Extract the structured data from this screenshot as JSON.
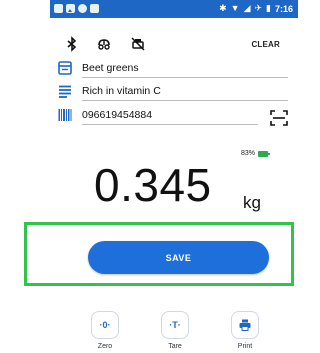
{
  "status_bar": {
    "time": "7:16",
    "accent": "#1e67c4"
  },
  "toolbar": {
    "icons": [
      "bluetooth-icon",
      "scale-icon",
      "scale-off-icon"
    ],
    "clear_label": "CLEAR"
  },
  "fields": {
    "name": "Beet greens",
    "description": "Rich in vitamin C",
    "barcode": "096619454884"
  },
  "scale": {
    "battery_percent": "83%",
    "weight": "0.345",
    "unit": "kg"
  },
  "save_label": "SAVE",
  "actions": [
    {
      "label": "Zero",
      "glyph": "·0·"
    },
    {
      "label": "Tare",
      "glyph": "·T·"
    },
    {
      "label": "Print",
      "glyph": ""
    }
  ],
  "colors": {
    "primary": "#1e6fd9",
    "highlight": "#33c24a",
    "battery": "#2fa84f"
  }
}
